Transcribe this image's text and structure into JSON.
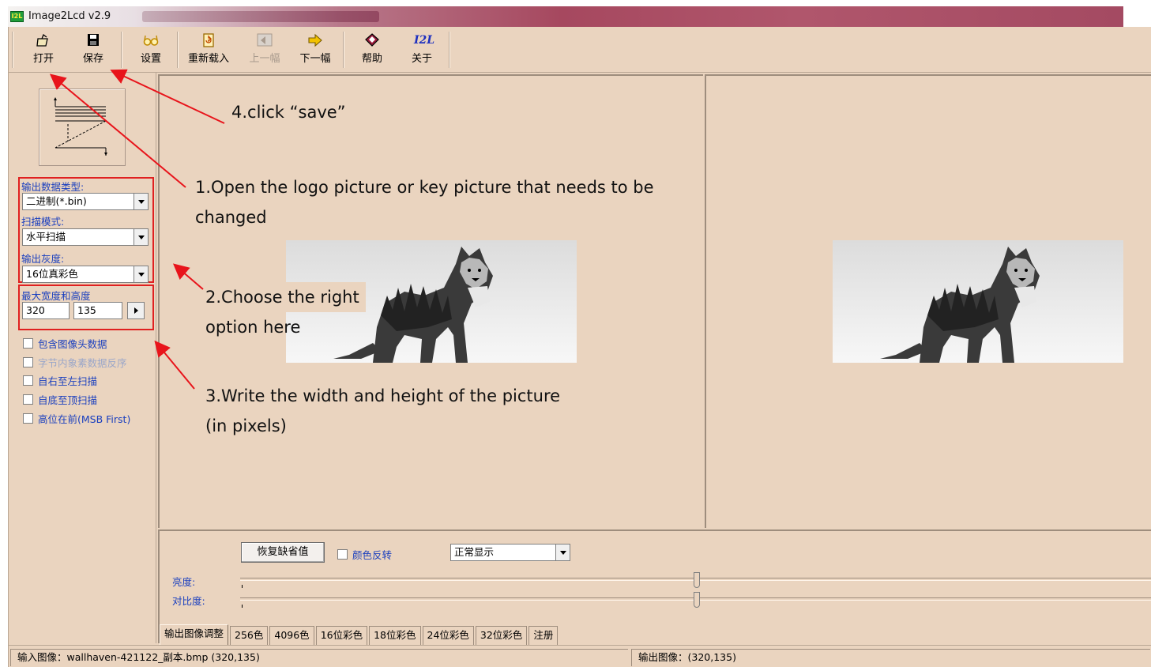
{
  "window": {
    "title": "Image2Lcd v2.9",
    "icon_label": "I2L"
  },
  "toolbar": {
    "buttons": [
      {
        "label": "打开",
        "icon": "open-folder-icon",
        "enabled": true
      },
      {
        "label": "保存",
        "icon": "floppy-disk-icon",
        "enabled": true
      },
      {
        "label": "设置",
        "icon": "glasses-icon",
        "enabled": true
      },
      {
        "label": "重新载入",
        "icon": "reload-document-icon",
        "enabled": true
      },
      {
        "label": "上一幅",
        "icon": "previous-image-icon",
        "enabled": false
      },
      {
        "label": "下一幅",
        "icon": "next-arrow-icon",
        "enabled": true
      },
      {
        "label": "帮助",
        "icon": "help-book-icon",
        "enabled": true
      },
      {
        "label": "关于",
        "icon": "i2l-logo-icon",
        "enabled": true,
        "icon_text": "I2L"
      }
    ]
  },
  "options": {
    "output_type_label": "输出数据类型:",
    "output_type_value": "二进制(*.bin)",
    "scan_mode_label": "扫描模式:",
    "scan_mode_value": "水平扫描",
    "output_gray_label": "输出灰度:",
    "output_gray_value": "16位真彩色",
    "max_size_label": "最大宽度和高度",
    "max_width": "320",
    "max_height": "135",
    "checkboxes": [
      {
        "label": "包含图像头数据",
        "checked": false,
        "enabled": true
      },
      {
        "label": "字节内象素数据反序",
        "checked": false,
        "enabled": false
      },
      {
        "label": "自右至左扫描",
        "checked": false,
        "enabled": true
      },
      {
        "label": "自底至顶扫描",
        "checked": false,
        "enabled": true
      },
      {
        "label": "高位在前(MSB First)",
        "checked": false,
        "enabled": true
      }
    ]
  },
  "adjust": {
    "restore_button": "恢复缺省值",
    "invert_label": "颜色反转",
    "invert_checked": false,
    "display_mode": "正常显示",
    "brightness_label": "亮度:",
    "contrast_label": "对比度:",
    "brightness_level": 0.5,
    "contrast_level": 0.5
  },
  "tabs": [
    {
      "label": "输出图像调整",
      "active": true
    },
    {
      "label": "256色",
      "active": false
    },
    {
      "label": "4096色",
      "active": false
    },
    {
      "label": "16位彩色",
      "active": false
    },
    {
      "label": "18位彩色",
      "active": false
    },
    {
      "label": "24位彩色",
      "active": false
    },
    {
      "label": "32位彩色",
      "active": false
    },
    {
      "label": "注册",
      "active": false
    }
  ],
  "status": {
    "input_image": "输入图像：wallhaven-421122_副本.bmp (320,135)",
    "output_image": "输出图像：(320,135)"
  },
  "annotations": {
    "step4": "4.click   “save”",
    "step1_line1": "1.Open the logo picture or key picture that needs to be",
    "step1_line2": "changed",
    "step2_line1": "2.Choose the right",
    "step2_line2": "option here",
    "step3_line1": "3.Write the width and height of the picture",
    "step3_line2": "(in pixels)",
    "arrow_color": "#e8141b"
  },
  "colors": {
    "window_bg": "#ead4bf",
    "highlight_box": "#e02020",
    "label_blue": "#1a3fbf"
  }
}
